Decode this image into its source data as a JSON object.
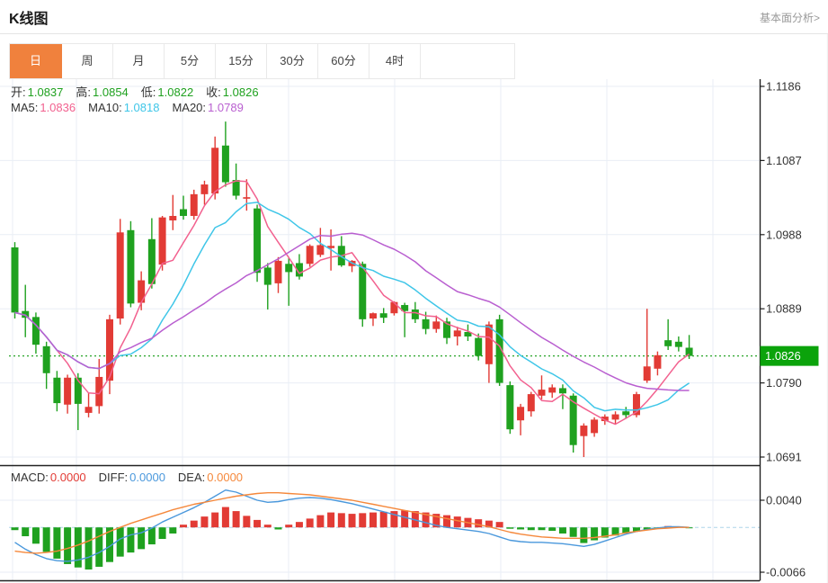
{
  "header": {
    "title": "K线图",
    "link": "基本面分析>"
  },
  "tabs": {
    "items": [
      "日",
      "周",
      "月",
      "5分",
      "15分",
      "30分",
      "60分",
      "4时"
    ],
    "names": [
      "day",
      "week",
      "month",
      "5min",
      "15min",
      "30min",
      "60min",
      "4hour"
    ],
    "selected_index": 0
  },
  "legend": {
    "open_label": "开:",
    "open_value": "1.0837",
    "high_label": "高:",
    "high_value": "1.0854",
    "low_label": "低:",
    "low_value": "1.0822",
    "close_label": "收:",
    "close_value": "1.0826",
    "ma5_label": "MA5:",
    "ma5_value": "1.0836",
    "ma10_label": "MA10:",
    "ma10_value": "1.0818",
    "ma20_label": "MA20:",
    "ma20_value": "1.0789",
    "macd_label": "MACD:",
    "macd_value": "0.0000",
    "diff_label": "DIFF:",
    "diff_value": "0.0000",
    "dea_label": "DEA:",
    "dea_value": "0.0000"
  },
  "colors": {
    "up_red": "#e23b35",
    "down_green": "#1fa11f",
    "badge_green": "#0ba30b",
    "ma5_pink": "#f2618f",
    "ma10_cyan": "#3fc6e8",
    "ma20_purple": "#b95fd0",
    "diff_blue": "#4a98dc",
    "dea_orange": "#f5883b",
    "tab_orange": "#f0813d",
    "price_line_green": "#2aa52a",
    "axis_dark": "#222222",
    "label_gray": "#333333",
    "grid_light": "#e9eef5",
    "zero_dash_blue": "#aed6ea"
  },
  "chart_data": {
    "type": "candlestick+macd",
    "title": "K线图",
    "grid": true,
    "legend_position": "top-left",
    "y_axis": {
      "labels": [
        "1.1186",
        "1.1087",
        "1.0988",
        "1.0889",
        "1.0790",
        "1.0691"
      ],
      "values": [
        1.1186,
        1.1087,
        1.0988,
        1.0889,
        1.079,
        1.0691
      ],
      "current_price_label": "1.0826",
      "current_price": 1.0826
    },
    "macd_axis": {
      "labels": [
        "0.0040",
        "-0.0066"
      ],
      "values": [
        0.004,
        -0.0066
      ],
      "zero": 0
    },
    "ohlc_current": {
      "open": 1.0837,
      "high": 1.0854,
      "low": 1.0822,
      "close": 1.0826
    },
    "ma_current": {
      "ma5": 1.0836,
      "ma10": 1.0818,
      "ma20": 1.0789
    },
    "ma_periods": [
      5,
      10,
      20
    ],
    "candles": [
      [
        1.0971,
        1.0978,
        1.0876,
        1.0884
      ],
      [
        1.0886,
        1.0921,
        1.0851,
        1.0877
      ],
      [
        1.0878,
        1.0884,
        1.0829,
        1.0841
      ],
      [
        1.0839,
        1.0845,
        1.0782,
        1.0803
      ],
      [
        1.0797,
        1.0806,
        1.0752,
        1.0763
      ],
      [
        1.0761,
        1.0801,
        1.0749,
        1.0797
      ],
      [
        1.0797,
        1.0803,
        1.0727,
        1.0762
      ],
      [
        1.075,
        1.0776,
        1.0744,
        1.0758
      ],
      [
        1.0759,
        1.0822,
        1.0749,
        1.0798
      ],
      [
        1.0793,
        1.0881,
        1.0775,
        1.0875
      ],
      [
        1.0876,
        1.1009,
        1.0868,
        1.0991
      ],
      [
        1.0994,
        1.1006,
        1.0891,
        1.0896
      ],
      [
        1.0897,
        1.0939,
        1.0887,
        1.0927
      ],
      [
        1.0982,
        1.101,
        1.0916,
        1.0922
      ],
      [
        1.0948,
        1.1013,
        1.094,
        1.1011
      ],
      [
        1.1007,
        1.1041,
        1.0994,
        1.1013
      ],
      [
        1.1022,
        1.104,
        1.1008,
        1.1013
      ],
      [
        1.1013,
        1.1048,
        1.1008,
        1.1042
      ],
      [
        1.1042,
        1.106,
        1.1028,
        1.1055
      ],
      [
        1.1043,
        1.1119,
        1.1035,
        1.1104
      ],
      [
        1.1107,
        1.1139,
        1.1052,
        1.1058
      ],
      [
        1.1061,
        1.1083,
        1.1035,
        1.104
      ],
      [
        1.1036,
        1.1062,
        1.102,
        1.1038
      ],
      [
        1.1023,
        1.1028,
        1.0925,
        1.0937
      ],
      [
        1.0944,
        1.095,
        1.0888,
        1.0921
      ],
      [
        1.0923,
        1.0958,
        1.091,
        1.0953
      ],
      [
        1.0949,
        1.0958,
        1.0893,
        1.0938
      ],
      [
        1.095,
        1.0962,
        1.0928,
        1.0932
      ],
      [
        1.0949,
        1.0975,
        1.0945,
        1.0973
      ],
      [
        1.0961,
        1.0997,
        1.0958,
        1.0974
      ],
      [
        1.097,
        1.0995,
        1.094,
        1.0973
      ],
      [
        1.0973,
        1.0986,
        1.0945,
        1.0947
      ],
      [
        1.0946,
        1.0954,
        1.0938,
        1.0953
      ],
      [
        1.0949,
        1.0952,
        1.0865,
        1.0875
      ],
      [
        1.0876,
        1.0884,
        1.0866,
        1.0883
      ],
      [
        1.0883,
        1.089,
        1.087,
        1.0877
      ],
      [
        1.0883,
        1.0899,
        1.088,
        1.0898
      ],
      [
        1.0894,
        1.0897,
        1.0851,
        1.0886
      ],
      [
        1.0888,
        1.0898,
        1.087,
        1.0875
      ],
      [
        1.0875,
        1.0885,
        1.0855,
        1.0862
      ],
      [
        1.0862,
        1.088,
        1.0857,
        1.0872
      ],
      [
        1.0872,
        1.0877,
        1.0842,
        1.085
      ],
      [
        1.0852,
        1.0865,
        1.084,
        1.086
      ],
      [
        1.0858,
        1.0868,
        1.0846,
        1.0852
      ],
      [
        1.085,
        1.0856,
        1.082,
        1.0826
      ],
      [
        1.0815,
        1.0872,
        1.079,
        1.0868
      ],
      [
        1.0875,
        1.0881,
        1.0786,
        1.079
      ],
      [
        1.0787,
        1.0792,
        1.0722,
        1.0728
      ],
      [
        1.074,
        1.0762,
        1.072,
        1.0758
      ],
      [
        1.0752,
        1.0778,
        1.0745,
        1.0775
      ],
      [
        1.0773,
        1.08,
        1.0768,
        1.0781
      ],
      [
        1.0777,
        1.0788,
        1.077,
        1.0784
      ],
      [
        1.0783,
        1.0788,
        1.0755,
        1.0776
      ],
      [
        1.0773,
        1.0776,
        1.0697,
        1.0707
      ],
      [
        1.0719,
        1.0736,
        1.0691,
        1.0733
      ],
      [
        1.0723,
        1.0744,
        1.0718,
        1.0741
      ],
      [
        1.0739,
        1.0748,
        1.0734,
        1.0745
      ],
      [
        1.0741,
        1.0752,
        1.0735,
        1.0748
      ],
      [
        1.0752,
        1.0758,
        1.0742,
        1.0747
      ],
      [
        1.0747,
        1.0778,
        1.0744,
        1.0775
      ],
      [
        1.0793,
        1.0889,
        1.079,
        1.0812
      ],
      [
        1.0809,
        1.0832,
        1.08,
        1.0827
      ],
      [
        1.0847,
        1.0875,
        1.0834,
        1.0839
      ],
      [
        1.0845,
        1.0852,
        1.0832,
        1.0838
      ],
      [
        1.0837,
        1.0854,
        1.0822,
        1.0826
      ]
    ],
    "macd": {
      "histogram": [
        -0.0004,
        -0.0013,
        -0.0024,
        -0.0036,
        -0.0046,
        -0.0054,
        -0.0059,
        -0.0062,
        -0.0058,
        -0.0051,
        -0.0043,
        -0.0037,
        -0.0032,
        -0.0025,
        -0.0017,
        -0.0009,
        0.0004,
        0.001,
        0.0016,
        0.0022,
        0.003,
        0.0024,
        0.0017,
        0.0011,
        0.0004,
        -0.0003,
        0.0004,
        0.0008,
        0.0013,
        0.0018,
        0.0022,
        0.0021,
        0.002,
        0.0021,
        0.0022,
        0.0023,
        0.0024,
        0.0025,
        0.0024,
        0.0022,
        0.002,
        0.0018,
        0.0016,
        0.0014,
        0.0012,
        0.001,
        0.0008,
        -0.0002,
        -0.0003,
        -0.0004,
        -0.0004,
        -0.0005,
        -0.0009,
        -0.0014,
        -0.0023,
        -0.0019,
        -0.0015,
        -0.0012,
        -0.0009,
        -0.0006,
        -0.0003,
        -0.0002,
        0.0002,
        0.0001,
        -0.0001
      ],
      "diff_line": [
        -0.0022,
        -0.0032,
        -0.004,
        -0.0046,
        -0.0049,
        -0.005,
        -0.0048,
        -0.0044,
        -0.0037,
        -0.0028,
        -0.0017,
        -0.0011,
        -0.0008,
        -0.0001,
        0.0008,
        0.0015,
        0.0022,
        0.0029,
        0.0037,
        0.0046,
        0.0055,
        0.0052,
        0.0046,
        0.004,
        0.0037,
        0.0038,
        0.0041,
        0.0043,
        0.0044,
        0.0043,
        0.0041,
        0.0038,
        0.0035,
        0.0031,
        0.0027,
        0.0023,
        0.0019,
        0.0015,
        0.0011,
        0.0007,
        0.0003,
        0.0,
        -0.0002,
        -0.0004,
        -0.0006,
        -0.0009,
        -0.0014,
        -0.0019,
        -0.0021,
        -0.0022,
        -0.0022,
        -0.0023,
        -0.0024,
        -0.0026,
        -0.0028,
        -0.0025,
        -0.002,
        -0.0015,
        -0.001,
        -0.0006,
        -0.0003,
        -0.0001,
        0.0001,
        0.0001,
        0.0
      ],
      "dea_line": [
        -0.0035,
        -0.0037,
        -0.0038,
        -0.0037,
        -0.0035,
        -0.0031,
        -0.0026,
        -0.002,
        -0.0013,
        -0.0006,
        0.0,
        0.0006,
        0.0011,
        0.0016,
        0.0021,
        0.0026,
        0.003,
        0.0034,
        0.0037,
        0.004,
        0.0043,
        0.0046,
        0.0048,
        0.005,
        0.0051,
        0.0051,
        0.005,
        0.0049,
        0.0048,
        0.0046,
        0.0044,
        0.0042,
        0.004,
        0.0037,
        0.0034,
        0.0031,
        0.0028,
        0.0025,
        0.0022,
        0.0019,
        0.0016,
        0.0013,
        0.001,
        0.0007,
        0.0004,
        0.0001,
        -0.0003,
        -0.0007,
        -0.001,
        -0.0012,
        -0.0014,
        -0.0015,
        -0.0016,
        -0.0016,
        -0.0016,
        -0.0015,
        -0.0013,
        -0.0011,
        -0.0008,
        -0.0006,
        -0.0004,
        -0.0002,
        -0.0001,
        0.0,
        0.0
      ]
    }
  }
}
